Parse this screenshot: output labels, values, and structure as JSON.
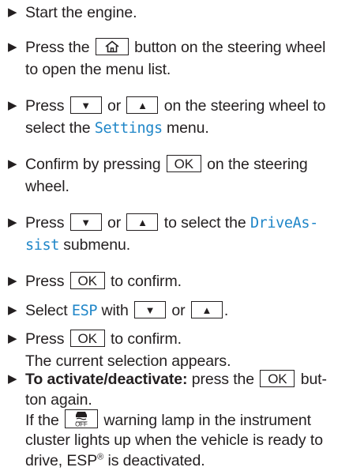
{
  "steps": [
    {
      "lines": [
        [
          "Start the engine."
        ]
      ]
    },
    {
      "lines": [
        [
          "Press the ",
          "{home}",
          " button on the steering wheel"
        ],
        [
          "to open the menu list."
        ]
      ]
    },
    {
      "lines": [
        [
          "Press ",
          "{down}",
          " or ",
          "{up}",
          " on the steering wheel to"
        ],
        [
          "select the ",
          "[Settings]",
          " menu."
        ]
      ]
    },
    {
      "lines": [
        [
          "Confirm by pressing ",
          "{ok}",
          " on the steering"
        ],
        [
          "wheel."
        ]
      ]
    },
    {
      "lines": [
        [
          "Press ",
          "{down}",
          " or ",
          "{up}",
          " to select the ",
          "[DriveAs-]"
        ],
        [
          "[sist]",
          " submenu."
        ]
      ]
    },
    {
      "lines": [
        [
          "Press ",
          "{ok}",
          " to confirm."
        ]
      ]
    },
    {
      "lines": [
        [
          "Select ",
          "[ESP]",
          " with ",
          "{down}",
          " or ",
          "{up}",
          "."
        ]
      ]
    },
    {
      "lines": [
        [
          "Press ",
          "{ok}",
          " to confirm."
        ],
        [
          "The current selection appears."
        ]
      ]
    },
    {
      "lines": [
        [
          "*To activate/deactivate:*",
          " press the ",
          "{ok}",
          " but-"
        ],
        [
          "ton again."
        ],
        [
          "If the ",
          "{esp}",
          " warning lamp in the instrument"
        ],
        [
          "cluster lights up when the vehicle is ready to"
        ],
        [
          "drive, ESP",
          "^®",
          " is deactivated."
        ]
      ]
    }
  ],
  "keys": {
    "ok": "OK",
    "up": "▲",
    "down": "▼"
  },
  "icons": {
    "arrow": "▶",
    "home": "home-icon",
    "esp": "esp-off-icon"
  },
  "colors": {
    "text": "#231f20",
    "highlight": "#1f86c8"
  }
}
